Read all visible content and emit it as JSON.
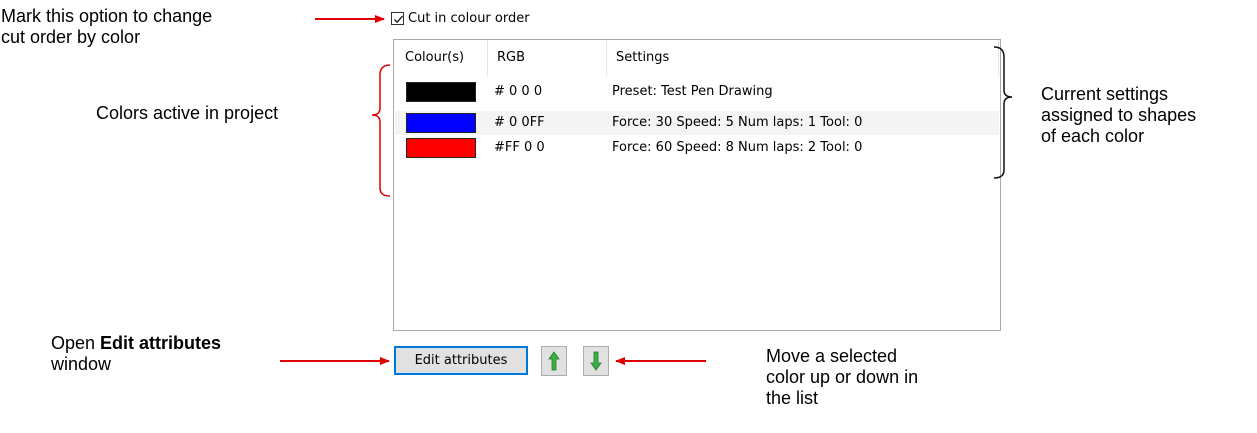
{
  "dialog": {
    "checkbox_label": "Cut in colour order",
    "checkbox_checked": true,
    "columns": [
      "Colour(s)",
      "RGB",
      "Settings"
    ],
    "rows": [
      {
        "color": "#000000",
        "rgb": "# 0 0 0",
        "settings": "Preset: Test Pen Drawing"
      },
      {
        "color": "#0000ff",
        "rgb": "# 0 0FF",
        "settings": "Force: 30 Speed: 5 Num laps: 1 Tool: 0"
      },
      {
        "color": "#ff0000",
        "rgb": "#FF 0 0",
        "settings": "Force: 60 Speed: 8 Num laps: 2 Tool: 0"
      }
    ],
    "edit_button_label": "Edit attributes",
    "up_icon": "green-up-arrow-icon",
    "down_icon": "green-down-arrow-icon"
  },
  "annotations": {
    "checkbox_note_line1": "Mark this option to change",
    "checkbox_note_line2": "cut order by color",
    "colors_note": "Colors active in project",
    "settings_note_line1": "Current settings",
    "settings_note_line2": "assigned to shapes",
    "settings_note_line3": "of each color",
    "edit_note_prefix": "Open ",
    "edit_note_bold": "Edit attributes",
    "edit_note_line2": "window",
    "move_note_line1": "Move a selected",
    "move_note_line2": "color up or down in",
    "move_note_line3": "the list"
  },
  "colors": {
    "arrow": "#e00000",
    "accent": "#0078d7",
    "green_arrow": "#3cb043"
  }
}
